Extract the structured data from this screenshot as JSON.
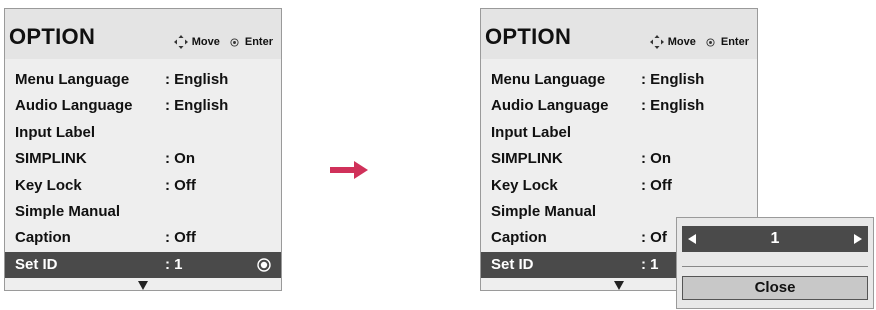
{
  "left_menu": {
    "title": "OPTION",
    "hints": {
      "move": "Move",
      "enter": "Enter"
    },
    "items": [
      {
        "label": "Menu Language",
        "value": ": English"
      },
      {
        "label": "Audio Language",
        "value": ": English"
      },
      {
        "label": "Input Label",
        "value": ""
      },
      {
        "label": "SIMPLINK",
        "value": ": On"
      },
      {
        "label": "Key Lock",
        "value": ": Off"
      },
      {
        "label": "Simple Manual",
        "value": ""
      },
      {
        "label": "Caption",
        "value": ": Off"
      },
      {
        "label": "Set ID",
        "value": ": 1"
      }
    ],
    "selected_index": 7
  },
  "right_menu": {
    "title": "OPTION",
    "hints": {
      "move": "Move",
      "enter": "Enter"
    },
    "items": [
      {
        "label": "Menu Language",
        "value": ": English"
      },
      {
        "label": "Audio Language",
        "value": ": English"
      },
      {
        "label": "Input Label",
        "value": ""
      },
      {
        "label": "SIMPLINK",
        "value": ": On"
      },
      {
        "label": "Key Lock",
        "value": ": Off"
      },
      {
        "label": "Simple Manual",
        "value": ""
      },
      {
        "label": "Caption",
        "value": ": Of"
      },
      {
        "label": "Set ID",
        "value": ": 1"
      }
    ],
    "selected_index": 7
  },
  "popup": {
    "value": "1",
    "close_label": "Close"
  },
  "colors": {
    "panel_bg": "#e8e8e8",
    "selected_bg": "#4a4a4a",
    "arrow": "#d0315a"
  }
}
